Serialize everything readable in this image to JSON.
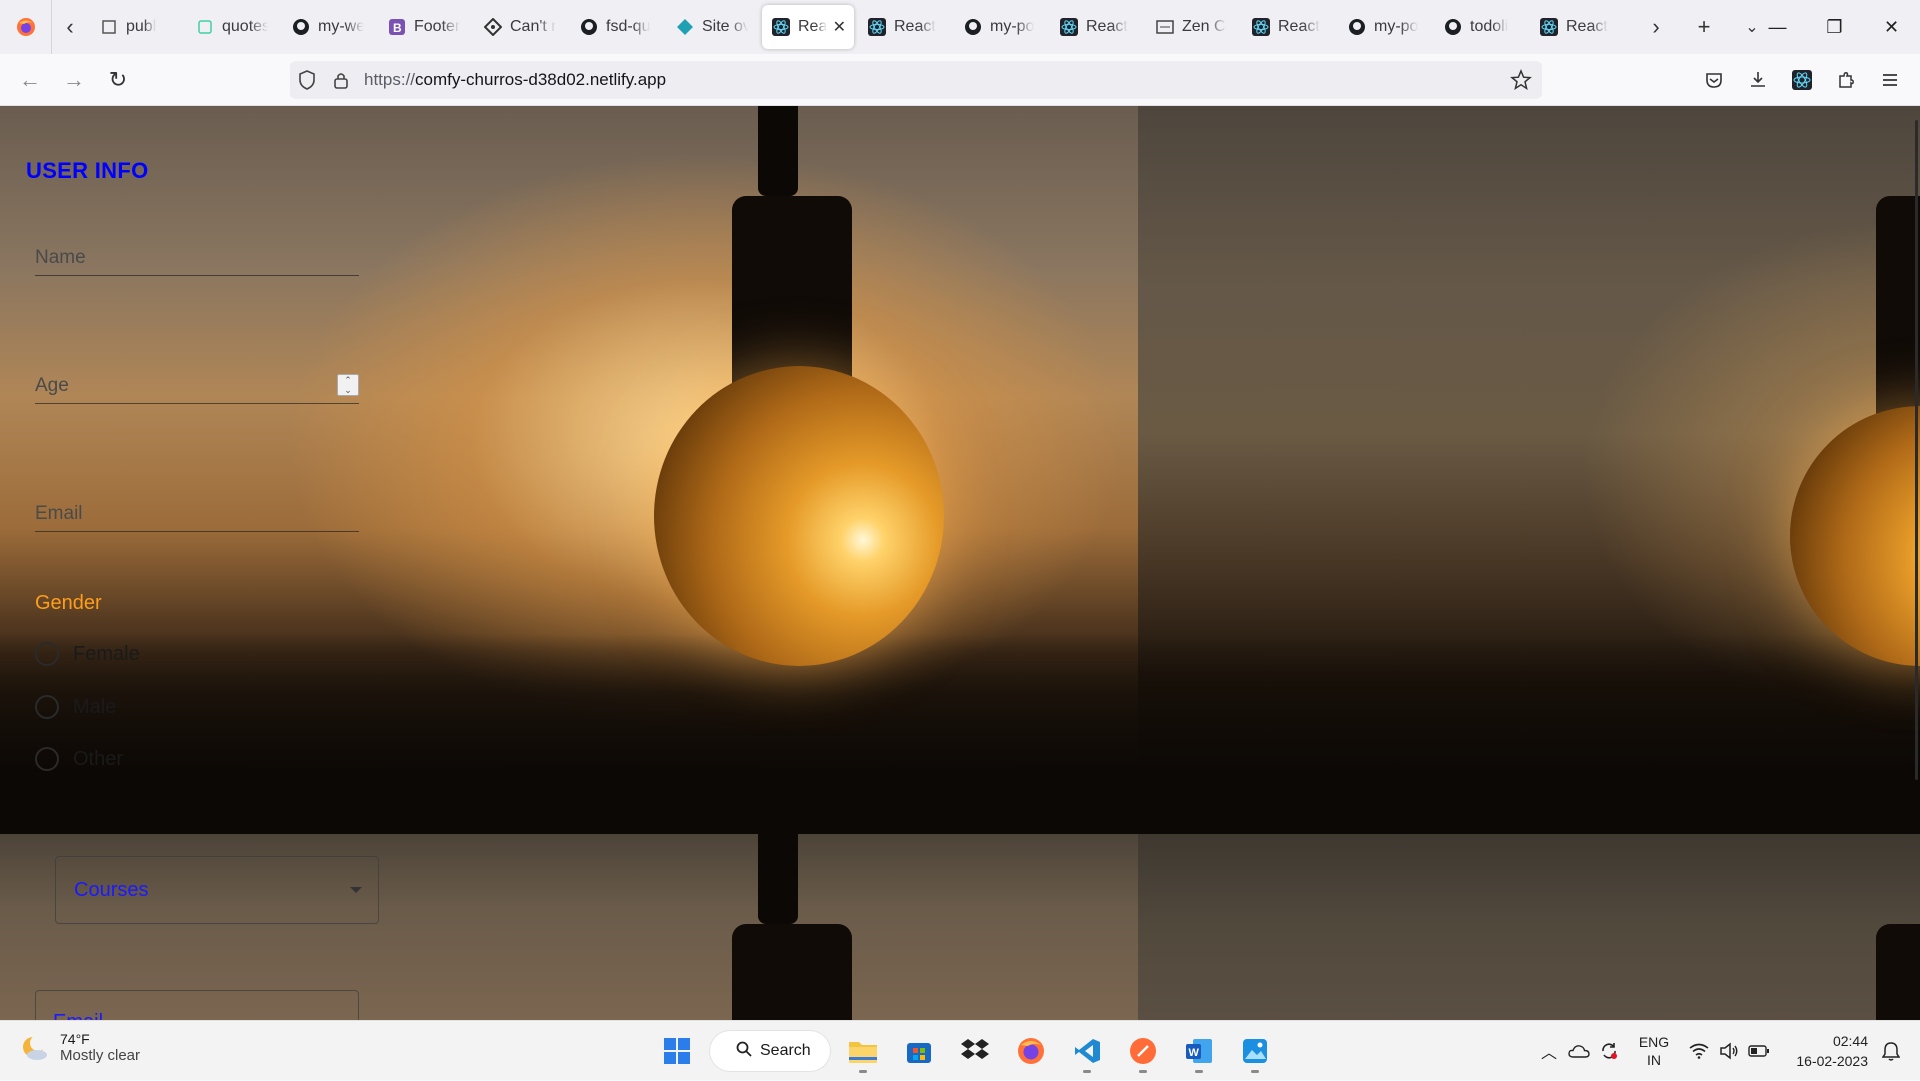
{
  "browser": {
    "tabs": [
      {
        "label": "publ",
        "icon": "box-icon"
      },
      {
        "label": "quotes",
        "icon": "codepen-icon"
      },
      {
        "label": "my-web",
        "icon": "github-icon"
      },
      {
        "label": "Footer",
        "icon": "bootstrap-icon"
      },
      {
        "label": "Can't r",
        "icon": "gem-icon"
      },
      {
        "label": "fsd-qu",
        "icon": "github-icon"
      },
      {
        "label": "Site ov",
        "icon": "netlify-icon"
      },
      {
        "label": "Rea",
        "icon": "react-icon",
        "active": true
      },
      {
        "label": "React",
        "icon": "react-icon"
      },
      {
        "label": "my-po",
        "icon": "github-icon"
      },
      {
        "label": "React",
        "icon": "react-icon"
      },
      {
        "label": "Zen C",
        "icon": "zen-icon"
      },
      {
        "label": "React",
        "icon": "react-icon"
      },
      {
        "label": "my-po",
        "icon": "github-icon"
      },
      {
        "label": "todoli",
        "icon": "github-icon"
      },
      {
        "label": "React",
        "icon": "react-icon"
      }
    ],
    "url_scheme": "https://",
    "url_host": "comfy-churros-d38d02.netlify.app"
  },
  "form": {
    "title": "USER INFO",
    "name_placeholder": "Name",
    "age_placeholder": "Age",
    "email_placeholder": "Email",
    "gender_label": "Gender",
    "gender_options": [
      "Female",
      "Male",
      "Other"
    ],
    "courses_value": "Courses",
    "email2_label": "Email"
  },
  "taskbar": {
    "weather_temp": "74°F",
    "weather_cond": "Mostly clear",
    "search_label": "Search",
    "lang_line1": "ENG",
    "lang_line2": "IN",
    "time": "02:44",
    "date": "16-02-2023"
  },
  "colors": {
    "form_title": "#0000ff",
    "gender_label": "#ff9e1b",
    "select_text": "#1a1aff",
    "active_indicator": "#c41b8d"
  }
}
